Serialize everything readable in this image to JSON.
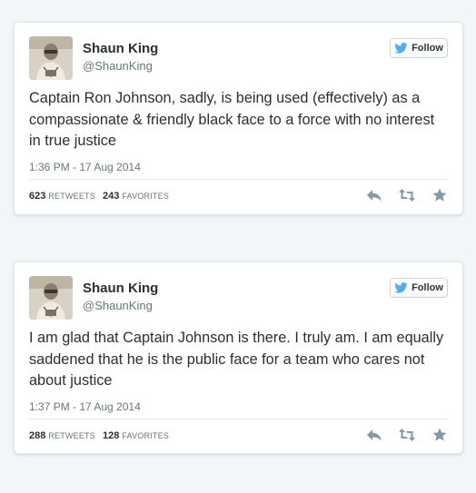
{
  "colors": {
    "page_background": "#f2f6f9",
    "card_border": "#e1e8ed",
    "name_text": "#292f33",
    "muted_text": "#66757f",
    "twitter_blue": "#55acee",
    "action_icon": "#8899a6"
  },
  "icons": {
    "follow": "twitter-bird-icon",
    "reply": "reply-icon",
    "retweet": "retweet-icon",
    "favorite": "star-icon"
  },
  "tweets": [
    {
      "name": "Shaun King",
      "handle": "@ShaunKing",
      "follow_label": "Follow",
      "text": "Captain Ron Johnson, sadly, is being used (effectively) as a compassionate & friendly black face to a force with no interest in true justice",
      "timestamp": "1:36 PM - 17 Aug 2014",
      "retweets": "623",
      "retweets_label": "RETWEETS",
      "favorites": "243",
      "favorites_label": "FAVORITES"
    },
    {
      "name": "Shaun King",
      "handle": "@ShaunKing",
      "follow_label": "Follow",
      "text": "I am glad that Captain Johnson is there. I truly am. I am equally saddened that he is the public face for a team who cares not about justice",
      "timestamp": "1:37 PM - 17 Aug 2014",
      "retweets": "288",
      "retweets_label": "RETWEETS",
      "favorites": "128",
      "favorites_label": "FAVORITES"
    }
  ]
}
